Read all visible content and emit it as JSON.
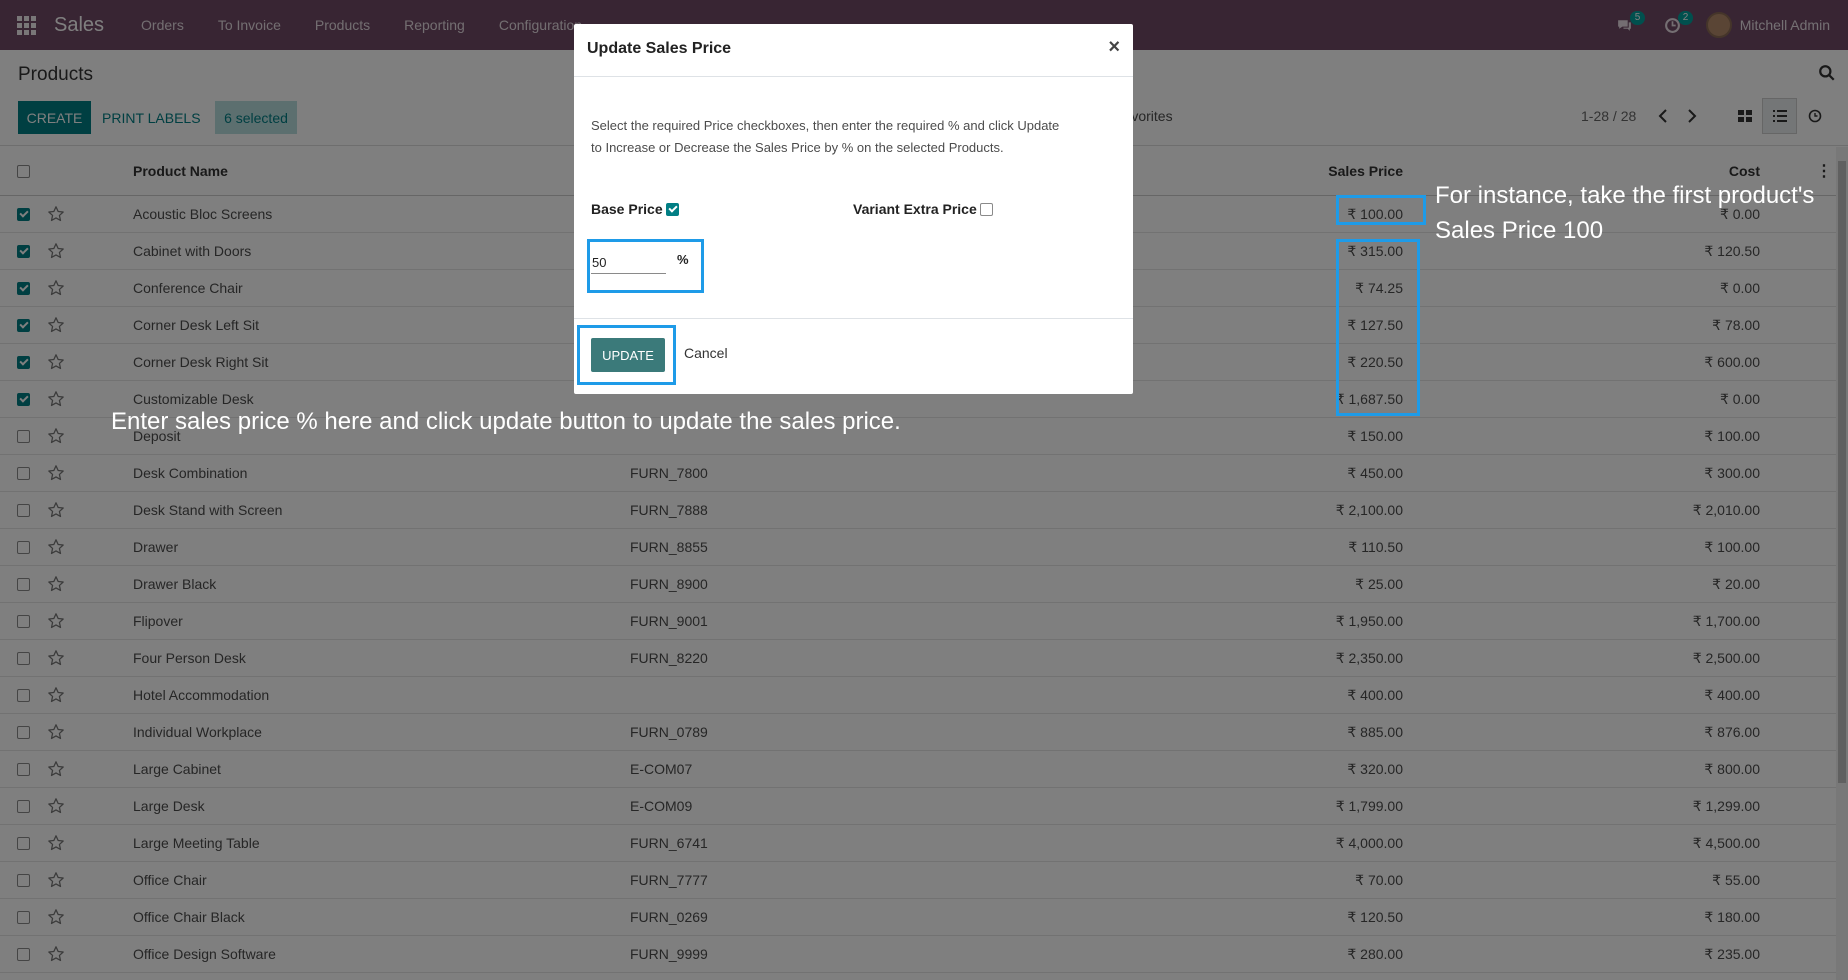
{
  "navbar": {
    "brand": "Sales",
    "menu": [
      "Orders",
      "To Invoice",
      "Products",
      "Reporting",
      "Configuration"
    ],
    "messages_count": "5",
    "activities_count": "2",
    "user_name": "Mitchell Admin"
  },
  "control": {
    "title": "Products",
    "create_label": "CREATE",
    "print_labels_label": "PRINT LABELS",
    "selected_label": "6 selected",
    "favorites_label": "Favorites",
    "pager": "1-28 / 28"
  },
  "table": {
    "headers": {
      "name": "Product Name",
      "price": "Sales Price",
      "cost": "Cost"
    },
    "rows": [
      {
        "checked": true,
        "name": "Acoustic Bloc Screens",
        "ref": "",
        "price": "₹ 100.00",
        "cost": "₹ 0.00"
      },
      {
        "checked": true,
        "name": "Cabinet with Doors",
        "ref": "",
        "price": "₹ 315.00",
        "cost": "₹ 120.50"
      },
      {
        "checked": true,
        "name": "Conference Chair",
        "ref": "",
        "price": "₹ 74.25",
        "cost": "₹ 0.00"
      },
      {
        "checked": true,
        "name": "Corner Desk Left Sit",
        "ref": "",
        "price": "₹ 127.50",
        "cost": "₹ 78.00"
      },
      {
        "checked": true,
        "name": "Corner Desk Right Sit",
        "ref": "",
        "price": "₹ 220.50",
        "cost": "₹ 600.00"
      },
      {
        "checked": true,
        "name": "Customizable Desk",
        "ref": "",
        "price": "₹ 1,687.50",
        "cost": "₹ 0.00"
      },
      {
        "checked": false,
        "name": "Deposit",
        "ref": "",
        "price": "₹ 150.00",
        "cost": "₹ 100.00"
      },
      {
        "checked": false,
        "name": "Desk Combination",
        "ref": "FURN_7800",
        "price": "₹ 450.00",
        "cost": "₹ 300.00"
      },
      {
        "checked": false,
        "name": "Desk Stand with Screen",
        "ref": "FURN_7888",
        "price": "₹ 2,100.00",
        "cost": "₹ 2,010.00"
      },
      {
        "checked": false,
        "name": "Drawer",
        "ref": "FURN_8855",
        "price": "₹ 110.50",
        "cost": "₹ 100.00"
      },
      {
        "checked": false,
        "name": "Drawer Black",
        "ref": "FURN_8900",
        "price": "₹ 25.00",
        "cost": "₹ 20.00"
      },
      {
        "checked": false,
        "name": "Flipover",
        "ref": "FURN_9001",
        "price": "₹ 1,950.00",
        "cost": "₹ 1,700.00"
      },
      {
        "checked": false,
        "name": "Four Person Desk",
        "ref": "FURN_8220",
        "price": "₹ 2,350.00",
        "cost": "₹ 2,500.00"
      },
      {
        "checked": false,
        "name": "Hotel Accommodation",
        "ref": "",
        "price": "₹ 400.00",
        "cost": "₹ 400.00"
      },
      {
        "checked": false,
        "name": "Individual Workplace",
        "ref": "FURN_0789",
        "price": "₹ 885.00",
        "cost": "₹ 876.00"
      },
      {
        "checked": false,
        "name": "Large Cabinet",
        "ref": "E-COM07",
        "price": "₹ 320.00",
        "cost": "₹ 800.00"
      },
      {
        "checked": false,
        "name": "Large Desk",
        "ref": "E-COM09",
        "price": "₹ 1,799.00",
        "cost": "₹ 1,299.00"
      },
      {
        "checked": false,
        "name": "Large Meeting Table",
        "ref": "FURN_6741",
        "price": "₹ 4,000.00",
        "cost": "₹ 4,500.00"
      },
      {
        "checked": false,
        "name": "Office Chair",
        "ref": "FURN_7777",
        "price": "₹ 70.00",
        "cost": "₹ 55.00"
      },
      {
        "checked": false,
        "name": "Office Chair Black",
        "ref": "FURN_0269",
        "price": "₹ 120.50",
        "cost": "₹ 180.00"
      },
      {
        "checked": false,
        "name": "Office Design Software",
        "ref": "FURN_9999",
        "price": "₹ 280.00",
        "cost": "₹ 235.00"
      }
    ]
  },
  "modal": {
    "title": "Update Sales Price",
    "close": "×",
    "description": "Select the required Price checkboxes, then enter the required % and click Update to Increase or Decrease the Sales Price by % on the selected Products.",
    "base_price_label": "Base Price",
    "base_price_checked": true,
    "variant_extra_label": "Variant Extra Price",
    "variant_extra_checked": false,
    "percent_value": "50",
    "percent_sign": "%",
    "update_label": "UPDATE",
    "cancel_label": "Cancel"
  },
  "annotations": {
    "price_note": "For instance, take the first product's Sales Price 100",
    "update_note": "Enter sales price % here and click update button to update the sales price.",
    "highlight_color": "#1e9be8"
  },
  "colors": {
    "navbar": "#714b67",
    "primary": "#017e84"
  }
}
